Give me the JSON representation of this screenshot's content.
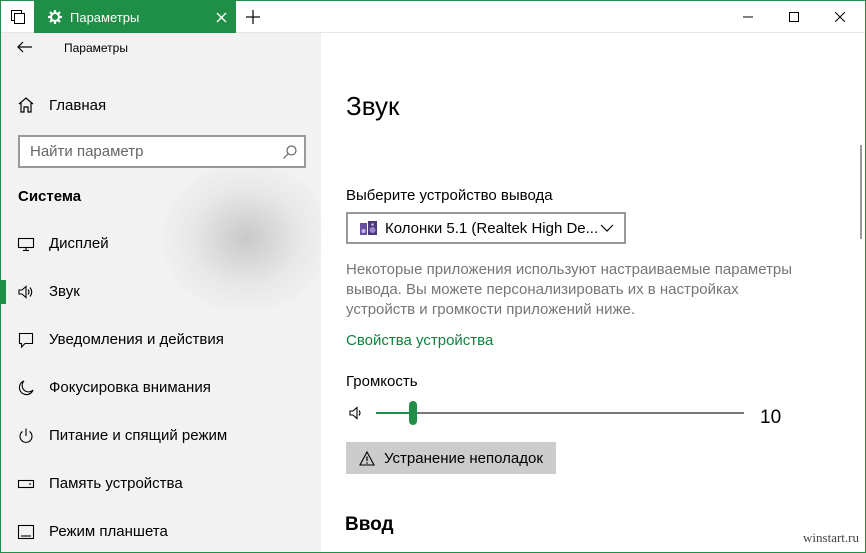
{
  "window": {
    "tab_title": "Параметры",
    "min_symbol": "—",
    "max_symbol": "☐",
    "close_symbol": "✕",
    "accent": "#1f8f47"
  },
  "sidebar": {
    "back_title": "Параметры",
    "home_label": "Главная",
    "search_placeholder": "Найти параметр",
    "section_title": "Система",
    "items": [
      {
        "label": "Дисплей",
        "icon": "monitor-icon"
      },
      {
        "label": "Звук",
        "icon": "speaker-icon",
        "selected": true
      },
      {
        "label": "Уведомления и действия",
        "icon": "notification-icon"
      },
      {
        "label": "Фокусировка внимания",
        "icon": "moon-icon"
      },
      {
        "label": "Питание и спящий режим",
        "icon": "power-icon"
      },
      {
        "label": "Память устройства",
        "icon": "storage-icon"
      },
      {
        "label": "Режим планшета",
        "icon": "tablet-icon"
      }
    ]
  },
  "main": {
    "title": "Звук",
    "output_label": "Выберите устройство вывода",
    "output_device": "Колонки 5.1 (Realtek High De...",
    "info_lines": [
      "Некоторые приложения используют настраиваемые параметры",
      "вывода. Вы можете персонализировать их в настройках",
      "устройств и громкости приложений ниже."
    ],
    "device_properties_link": "Свойства устройства",
    "volume_label": "Громкость",
    "volume_value": "10",
    "volume_fraction": 0.1,
    "troubleshoot_label": "Устранение неполадок",
    "input_heading": "Ввод",
    "link_color": "#12803d"
  },
  "watermark": "winstart.ru"
}
